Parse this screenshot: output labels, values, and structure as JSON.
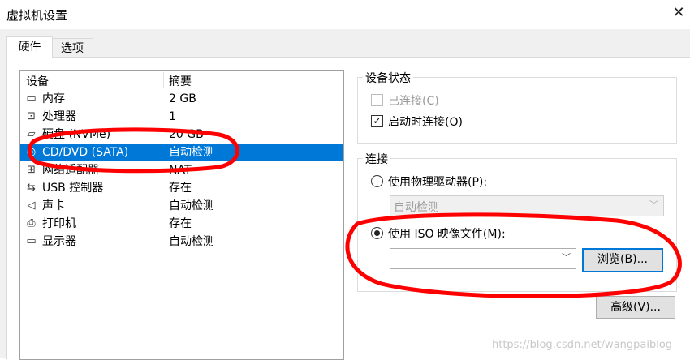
{
  "window": {
    "title": "虚拟机设置",
    "close_label": "✕"
  },
  "tabs": [
    {
      "label": "硬件",
      "active": true
    },
    {
      "label": "选项",
      "active": false
    }
  ],
  "device_list": {
    "columns": [
      "设备",
      "摘要"
    ],
    "rows": [
      {
        "icon": "memory-icon",
        "glyph": "▭",
        "device": "内存",
        "summary": "2 GB",
        "selected": false
      },
      {
        "icon": "processor-icon",
        "glyph": "⊡",
        "device": "处理器",
        "summary": "1",
        "selected": false
      },
      {
        "icon": "hard-disk-icon",
        "glyph": "▱",
        "device": "硬盘 (NVMe)",
        "summary": "20 GB",
        "selected": false
      },
      {
        "icon": "cd-dvd-icon",
        "glyph": "◎",
        "device": "CD/DVD (SATA)",
        "summary": "自动检测",
        "selected": true
      },
      {
        "icon": "network-adapter-icon",
        "glyph": "⊞",
        "device": "网络适配器",
        "summary": "NAT",
        "selected": false
      },
      {
        "icon": "usb-controller-icon",
        "glyph": "⇆",
        "device": "USB 控制器",
        "summary": "存在",
        "selected": false
      },
      {
        "icon": "sound-card-icon",
        "glyph": "◁",
        "device": "声卡",
        "summary": "自动检测",
        "selected": false
      },
      {
        "icon": "printer-icon",
        "glyph": "⎙",
        "device": "打印机",
        "summary": "存在",
        "selected": false
      },
      {
        "icon": "display-icon",
        "glyph": "▭",
        "device": "显示器",
        "summary": "自动检测",
        "selected": false
      }
    ]
  },
  "device_status": {
    "title": "设备状态",
    "connected_label": "已连接(C)",
    "connected_checked": false,
    "connected_enabled": false,
    "connect_at_power_on_label": "启动时连接(O)",
    "connect_at_power_on_checked": true,
    "checkmark": "✓"
  },
  "connection": {
    "title": "连接",
    "physical_drive_label": "使用物理驱动器(P):",
    "physical_drive_selected": false,
    "physical_drive_value": "自动检测",
    "iso_label": "使用 ISO 映像文件(M):",
    "iso_selected": true,
    "iso_path_value": "",
    "browse_label": "浏览(B)...",
    "dropdown_arrow": "﹀"
  },
  "advanced_label": "高级(V)...",
  "watermark": "https://blog.csdn.net/wangpaiblog",
  "colors": {
    "selection": "#0078d7",
    "annotation": "#ff0000"
  }
}
